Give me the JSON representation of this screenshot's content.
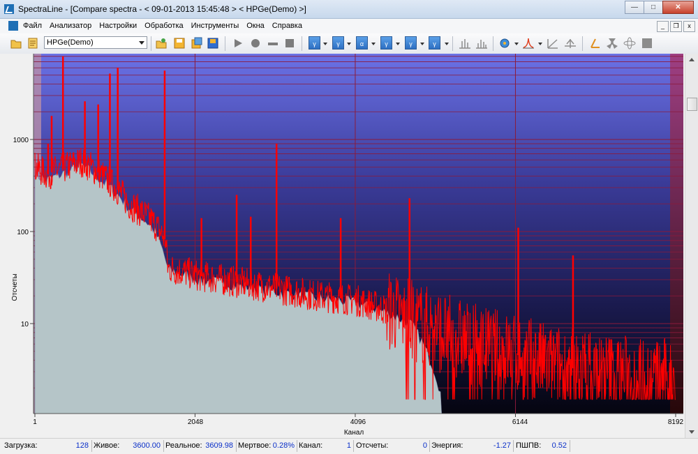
{
  "window": {
    "title": "SpectraLine - [Compare spectra - < 09-01-2013 15:45:48 > < HPGe(Demo) >]"
  },
  "window_buttons": {
    "minimize": "—",
    "maximize": "□",
    "close": "✕"
  },
  "menu": {
    "items": [
      "Файл",
      "Анализатор",
      "Настройки",
      "Обработка",
      "Инструменты",
      "Окна",
      "Справка"
    ]
  },
  "mdi_buttons": {
    "minimize": "_",
    "restore": "❐",
    "close": "x"
  },
  "toolbar": {
    "detector_combo": "HPGe(Demo)",
    "filter_buttons": [
      "γ",
      "γ",
      "α",
      "γ",
      "γ",
      "γ"
    ]
  },
  "chart": {
    "ylabel": "Отсчеты",
    "xlabel": "Канал",
    "y_ticks": [
      "1000",
      "100",
      "10"
    ],
    "x_ticks": [
      "1",
      "2048",
      "4096",
      "6144",
      "8192"
    ]
  },
  "colors": {
    "spectrum_red": "#ff0000",
    "spectrum_fill": "#b5c5c8",
    "grid": "#8b1a3b",
    "bg_top": "#6a6edb",
    "bg_bottom": "#070712"
  },
  "chart_data": {
    "type": "line",
    "xlabel": "Канал",
    "ylabel": "Отсчеты",
    "xlim": [
      1,
      8192
    ],
    "ylim": [
      1.5,
      9000
    ],
    "yscale": "log",
    "grid": true,
    "series": [
      {
        "x": [
          1,
          150,
          350,
          600,
          900,
          1200,
          1500,
          1670,
          1700,
          2100,
          2600,
          3100,
          3600,
          4096,
          4500,
          4800,
          5200,
          5600,
          6000,
          6600,
          7200,
          7900,
          8192
        ],
        "y": [
          500,
          420,
          480,
          580,
          380,
          200,
          130,
          80,
          40,
          33,
          28,
          24,
          20,
          18,
          14,
          11,
          8,
          6,
          5,
          3.5,
          3,
          2.5,
          2.5
        ]
      },
      {
        "x": [
          1,
          150,
          350,
          600,
          900,
          1200,
          1500,
          1700,
          2100,
          2600,
          3100,
          3600,
          4096,
          4500,
          4800,
          5000,
          5200
        ],
        "y": [
          420,
          360,
          420,
          520,
          330,
          180,
          110,
          38,
          30,
          26,
          22,
          19,
          17,
          13,
          10,
          5,
          1.5
        ]
      }
    ],
    "peaks": [
      {
        "x": 170,
        "y": 900
      },
      {
        "x": 215,
        "y": 1800
      },
      {
        "x": 360,
        "y": 8000
      },
      {
        "x": 640,
        "y": 2600
      },
      {
        "x": 810,
        "y": 2400
      },
      {
        "x": 960,
        "y": 5200
      },
      {
        "x": 1060,
        "y": 6000
      },
      {
        "x": 1660,
        "y": 5600
      },
      {
        "x": 2130,
        "y": 140
      },
      {
        "x": 2580,
        "y": 250
      },
      {
        "x": 2760,
        "y": 145
      },
      {
        "x": 3090,
        "y": 900
      },
      {
        "x": 3910,
        "y": 140
      },
      {
        "x": 4790,
        "y": 230
      },
      {
        "x": 6180,
        "y": 110
      },
      {
        "x": 6880,
        "y": 55
      }
    ]
  },
  "status": {
    "load_label": "Загрузка:",
    "load_value": "128",
    "live_label": "Живое:",
    "live_value": "3600.00",
    "real_label": "Реальное:",
    "real_value": "3609.98",
    "dead_label": "Мертвое:",
    "dead_value": "0.28%",
    "channel_label": "Канал:",
    "channel_value": "1",
    "counts_label": "Отсчеты:",
    "counts_value": "0",
    "energy_label": "Энергия:",
    "energy_value": "-1.27",
    "fwhm_label": "ПШПВ:",
    "fwhm_value": "0.52"
  }
}
